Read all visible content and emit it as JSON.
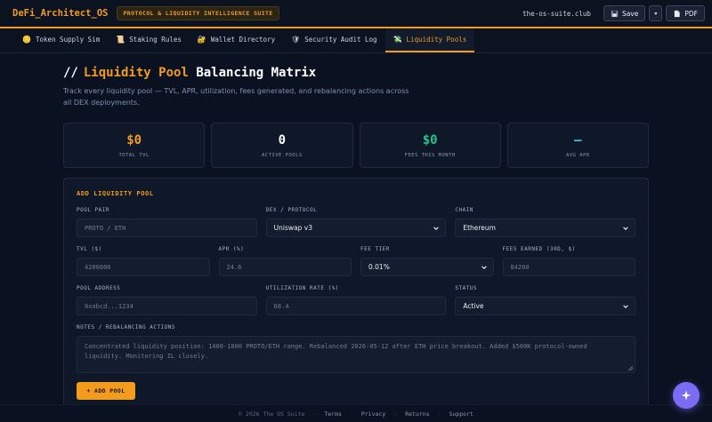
{
  "topbar": {
    "brand": "DeFi_Architect_OS",
    "badge": "PROTOCOL & LIQUIDITY INTELLIGENCE SUITE",
    "site": "the-os-suite.club",
    "save_label": "Save",
    "more_label": "▾",
    "pdf_label": "PDF"
  },
  "tabs": [
    {
      "emoji": "🪙",
      "label": "Token Supply Sim",
      "icon": "coin-icon"
    },
    {
      "emoji": "📜",
      "label": "Staking Rules",
      "icon": "scroll-icon"
    },
    {
      "emoji": "🔐",
      "label": "Wallet Directory",
      "icon": "lock-key-icon"
    },
    {
      "emoji": "🛡",
      "label": "Security Audit Log",
      "icon": "shield-icon"
    },
    {
      "emoji": "💸",
      "label": "Liquidity Pools",
      "icon": "money-wings-icon",
      "active": true
    }
  ],
  "page": {
    "slashes": "//",
    "title_accent": "Liquidity Pool",
    "title_rest": "Balancing Matrix",
    "subtitle": "Track every liquidity pool — TVL, APR, utilization, fees generated, and rebalancing actions across all DEX deployments."
  },
  "stats": [
    {
      "value": "$0",
      "label": "TOTAL TVL",
      "color": "#f29b1d"
    },
    {
      "value": "0",
      "label": "ACTIVE POOLS",
      "color": "#ffffff"
    },
    {
      "value": "$0",
      "label": "FEES THIS MONTH",
      "color": "#22c58b"
    },
    {
      "value": "—",
      "label": "AVG APR",
      "color": "#4fb8e6"
    }
  ],
  "form": {
    "title": "ADD LIQUIDITY POOL",
    "pool_pair": {
      "label": "POOL PAIR",
      "placeholder": "PROTO / ETH"
    },
    "dex": {
      "label": "DEX / PROTOCOL",
      "value": "Uniswap v3"
    },
    "chain": {
      "label": "CHAIN",
      "value": "Ethereum"
    },
    "tvl": {
      "label": "TVL ($)",
      "placeholder": "4200000"
    },
    "apr": {
      "label": "APR (%)",
      "placeholder": "24.6"
    },
    "fee_tier": {
      "label": "FEE TIER",
      "value": "0.01%"
    },
    "fees_earned": {
      "label": "FEES EARNED (30D, $)",
      "placeholder": "84200"
    },
    "pool_address": {
      "label": "POOL ADDRESS",
      "placeholder": "0xabcd...1234"
    },
    "utilization": {
      "label": "UTILIZATION RATE (%)",
      "placeholder": "68.4"
    },
    "status": {
      "label": "STATUS",
      "value": "Active"
    },
    "notes": {
      "label": "NOTES / REBALANCING ACTIONS",
      "placeholder": "Concentrated liquidity position: 1400-1800 PROTO/ETH range. Rebalanced 2026-05-12 after ETH price breakout. Added $500K protocol-owned liquidity. Monitoring IL closely."
    },
    "add_button": "+ ADD POOL"
  },
  "footer": {
    "copyright": "© 2026 The OS Suite",
    "links": [
      "Terms",
      "Privacy",
      "Returns",
      "Support"
    ]
  },
  "colors": {
    "accent": "#f29b1d",
    "fab": "#7b6cf6",
    "background": "#0a1222"
  }
}
